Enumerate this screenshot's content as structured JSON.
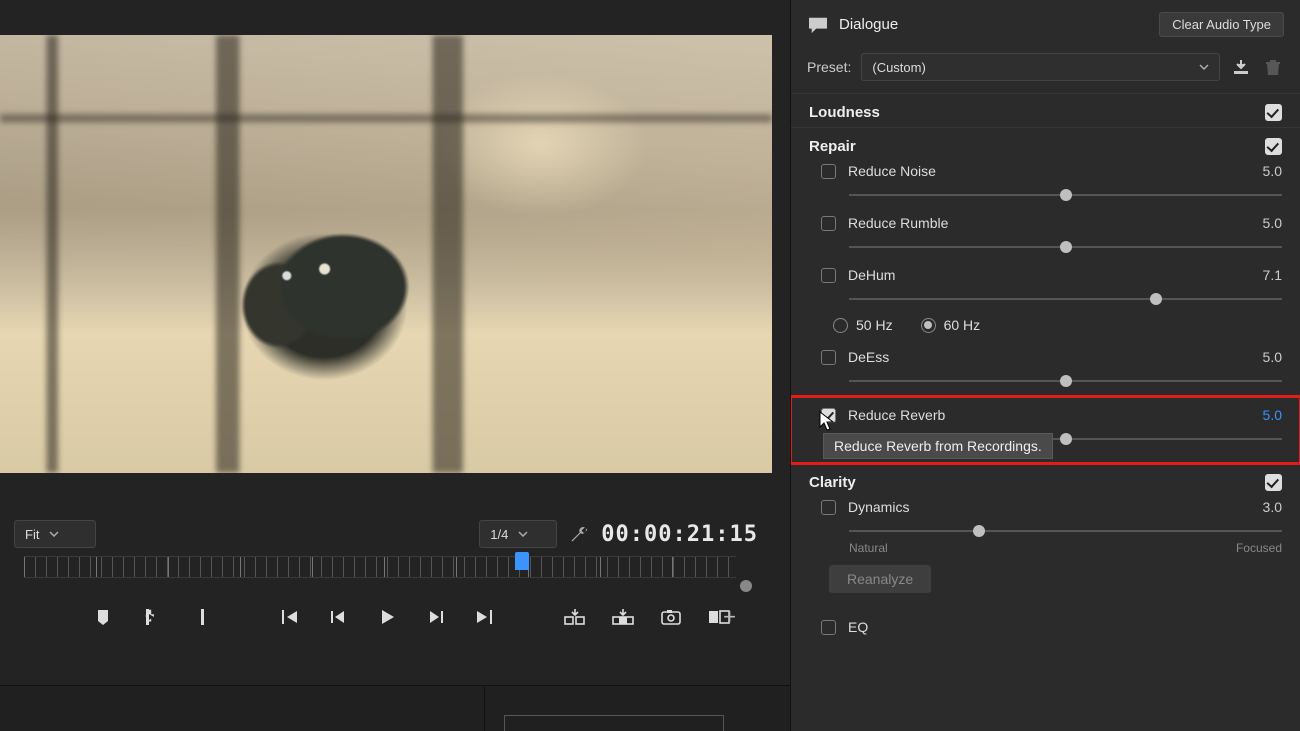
{
  "monitor": {
    "fit_label": "Fit",
    "res_label": "1/4",
    "timecode": "00:00:21:15",
    "playhead_pct": 70
  },
  "panel": {
    "title": "Dialogue",
    "clear_btn": "Clear Audio Type",
    "preset_label": "Preset:",
    "preset_value": "(Custom)"
  },
  "loudness": {
    "title": "Loudness",
    "enabled": true
  },
  "repair": {
    "title": "Repair",
    "enabled": true,
    "reduce_noise": {
      "label": "Reduce Noise",
      "checked": false,
      "value": "5.0",
      "pos": 50
    },
    "reduce_rumble": {
      "label": "Reduce Rumble",
      "checked": false,
      "value": "5.0",
      "pos": 50
    },
    "dehum": {
      "label": "DeHum",
      "checked": false,
      "value": "7.1",
      "pos": 71,
      "freq50": "50 Hz",
      "freq60": "60 Hz",
      "sel60": true
    },
    "deess": {
      "label": "DeEss",
      "checked": false,
      "value": "5.0",
      "pos": 50
    },
    "reduce_reverb": {
      "label": "Reduce Reverb",
      "checked": true,
      "value": "5.0",
      "pos": 50,
      "tooltip": "Reduce Reverb from Recordings."
    }
  },
  "clarity": {
    "title": "Clarity",
    "enabled": true,
    "dynamics": {
      "label": "Dynamics",
      "checked": false,
      "value": "3.0",
      "pos": 30,
      "min_label": "Natural",
      "max_label": "Focused"
    },
    "reanalyze": "Reanalyze",
    "eq": {
      "label": "EQ",
      "checked": false
    }
  }
}
